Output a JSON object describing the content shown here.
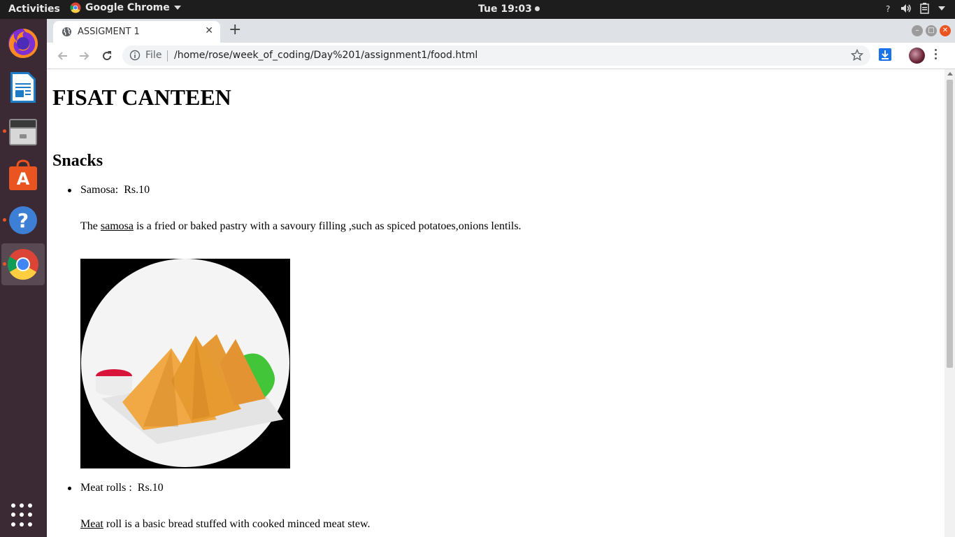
{
  "topbar": {
    "activities": "Activities",
    "app_name": "Google Chrome",
    "clock": "Tue 19:03"
  },
  "dock": {
    "items": [
      "firefox-icon",
      "writer-icon",
      "files-icon",
      "software-center-icon",
      "help-icon",
      "chrome-icon"
    ]
  },
  "browser": {
    "tab_title": "ASSIGMENT 1",
    "scheme_label": "File",
    "url": "/home/rose/week_of_coding/Day%201/assignment1/food.html"
  },
  "page": {
    "heading": "FISAT CANTEEN",
    "section_title": "Snacks",
    "items": [
      {
        "label": "Samosa:  Rs.10",
        "desc_prefix": "The ",
        "desc_link": "samosa",
        "desc_suffix": " is a fried or baked pastry with a savoury filling ,such as spiced potatoes,onions lentils."
      },
      {
        "label": "Meat rolls :  Rs.10",
        "desc_prefix": "",
        "desc_link": "Meat",
        "desc_suffix": " roll is a basic bread stuffed with cooked minced meat stew."
      }
    ]
  },
  "colors": {
    "ubuntu_orange": "#e95420",
    "dock_bg": "#3b2a34",
    "topbar_bg": "#1d1d1d"
  }
}
